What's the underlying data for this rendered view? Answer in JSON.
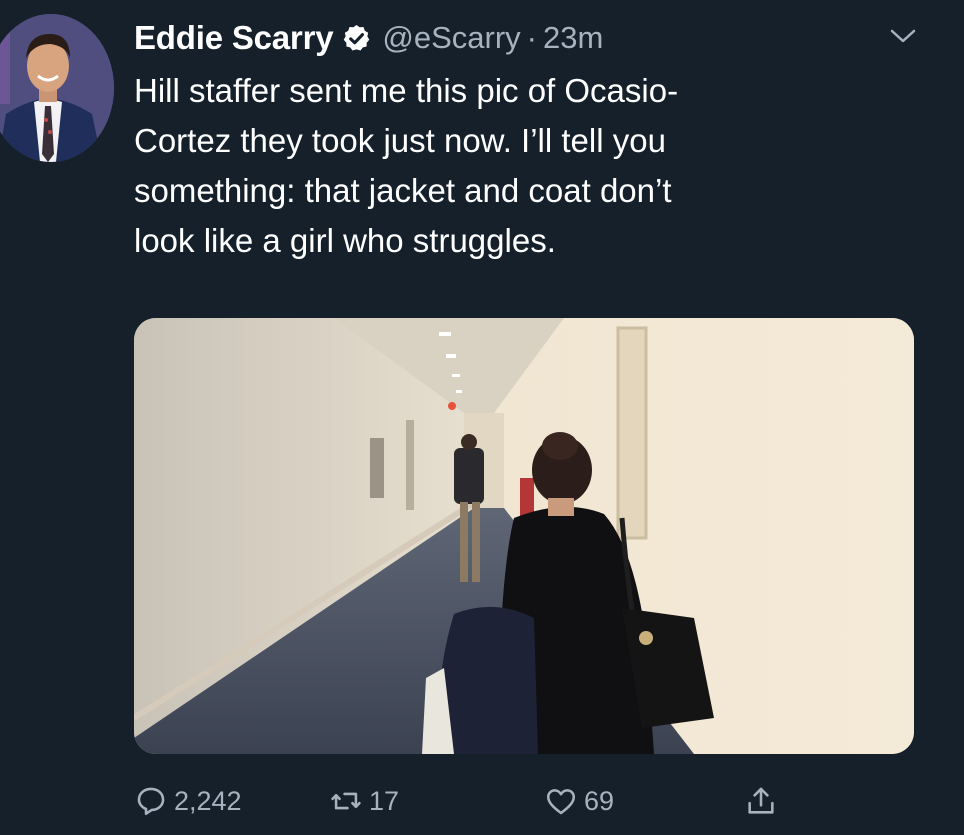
{
  "tweet": {
    "display_name": "Eddie Scarry",
    "verified_icon": "verified-badge-icon",
    "handle": "@eScarry",
    "separator": "·",
    "time": "23m",
    "menu_icon": "chevron-down-icon",
    "text_lines": [
      "Hill staffer sent me this pic of Ocasio-",
      "Cortez they took just now. I’ll tell you",
      "something: that jacket and coat don’t",
      "look like a girl who struggles."
    ],
    "media_icon": "photo-hallway"
  },
  "actions": {
    "reply_count": "2,242",
    "retweet_count": "17",
    "like_count": "69",
    "reply_icon": "reply-icon",
    "retweet_icon": "retweet-icon",
    "like_icon": "heart-icon",
    "share_icon": "share-icon"
  },
  "colors": {
    "background": "#15202b",
    "primary_text": "#ffffff",
    "secondary_text": "#a6b2be"
  }
}
